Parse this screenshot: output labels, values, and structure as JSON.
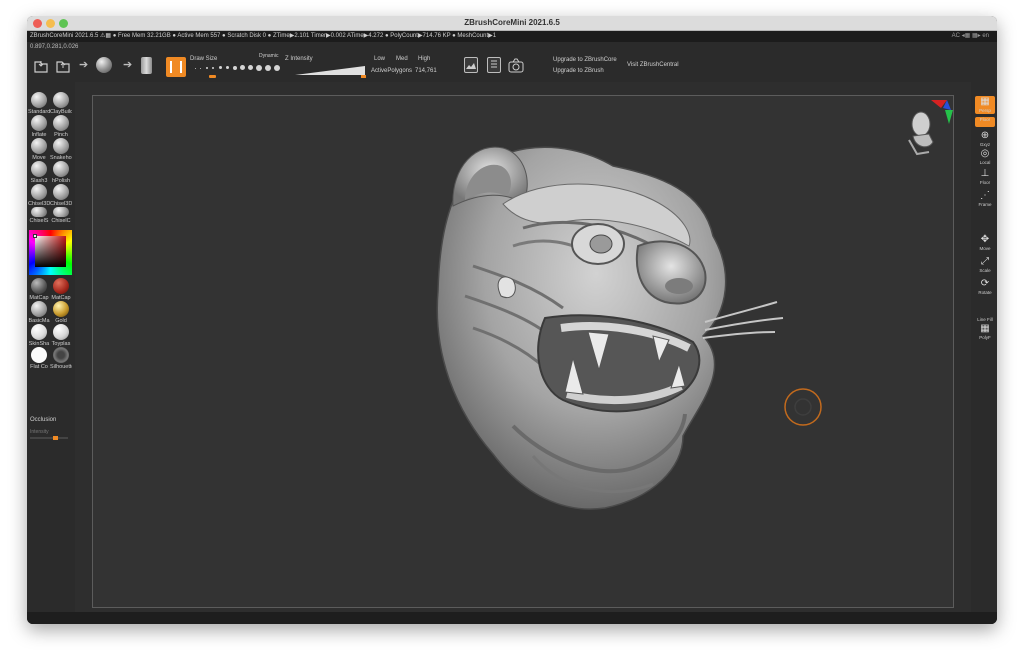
{
  "window": {
    "title": "ZBrushCoreMini 2021.6.5"
  },
  "info_bar": {
    "left": "ZBrushCoreMini 2021.6.5 ⚠▦   ● Free Mem 32.21GB ● Active Mem 557 ● Scratch Disk 0 ●  ZTime▶2.101 Timer▶0.002 ATime▶4.272  ● PolyCount▶714.76 KP  ● MeshCount▶1",
    "right": "AC ◂▦ ▦▸ en"
  },
  "coords": "0.897,0.281,0.026",
  "toolbar": {
    "draw_size_label": "Draw Size",
    "dynamic_label": "Dynamic",
    "z_intensity_label": "Z Intensity",
    "res_low": "Low",
    "res_med": "Med",
    "res_high": "High",
    "active_polygons_label": "ActivePolygons",
    "active_polygons_value": "714,761",
    "upgrade_core": "Upgrade to ZBrushCore",
    "upgrade_zbrush": "Upgrade to ZBrush",
    "visit_central": "Visit ZBrushCentral"
  },
  "brushes": [
    {
      "name": "Standard"
    },
    {
      "name": "ClayBuildup"
    },
    {
      "name": "Inflate"
    },
    {
      "name": "Pinch"
    },
    {
      "name": "Move"
    },
    {
      "name": "Snakehook"
    },
    {
      "name": "Slash3"
    },
    {
      "name": "hPolish"
    },
    {
      "name": "Chisel3D"
    },
    {
      "name": "Chisel3D"
    },
    {
      "name": "ChiselS"
    },
    {
      "name": "ChiselC"
    }
  ],
  "materials": [
    {
      "name": "MatCap"
    },
    {
      "name": "MatCap"
    },
    {
      "name": "BasicMa"
    },
    {
      "name": "Gold"
    },
    {
      "name": "SkinSha"
    },
    {
      "name": "Toyplas"
    },
    {
      "name": "Flat Co"
    },
    {
      "name": "Silhouette"
    }
  ],
  "occlusion": {
    "label": "Occlusion",
    "sublabel": "Intensity"
  },
  "right_shelf": [
    {
      "label": "Persp",
      "icon": "perspective-icon"
    },
    {
      "label": "Floor",
      "icon": "floor-icon"
    },
    {
      "label": "Gxyz",
      "icon": "gizmo-icon"
    },
    {
      "label": "Local",
      "icon": "local-icon"
    },
    {
      "label": "Floor",
      "icon": "floor-grid-icon"
    },
    {
      "label": "Frame",
      "icon": "frame-icon"
    },
    {
      "label": "Move",
      "icon": "move-icon"
    },
    {
      "label": "Scale",
      "icon": "scale-icon"
    },
    {
      "label": "Rotate",
      "icon": "rotate-icon"
    },
    {
      "label": "Line Fill",
      "icon": "line-fill-icon"
    },
    {
      "label": "PolyF",
      "icon": "polyframe-icon"
    }
  ],
  "colors": {
    "accent": "#f08a24",
    "canvas": "#333333",
    "panel": "#2b2b2b"
  }
}
